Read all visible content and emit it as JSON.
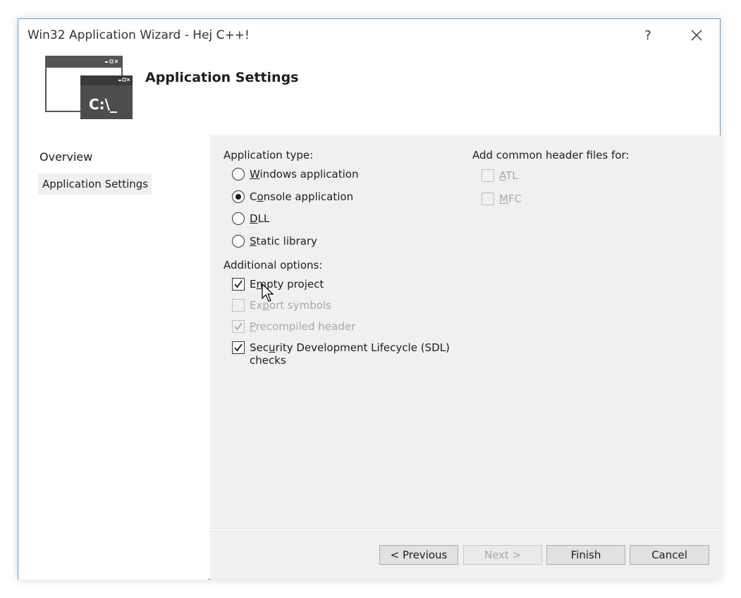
{
  "window": {
    "title": "Win32 Application Wizard - Hej C++!",
    "help_label": "?"
  },
  "header": {
    "title": "Application Settings",
    "icon_text": "C:\\_"
  },
  "sidebar": {
    "items": [
      {
        "label": "Overview"
      },
      {
        "label": "Application Settings"
      }
    ]
  },
  "app_type": {
    "label": "Application type:",
    "options": [
      {
        "pre": "",
        "u": "W",
        "post": "indows application",
        "selected": false
      },
      {
        "pre": "C",
        "u": "o",
        "post": "nsole application",
        "selected": true
      },
      {
        "pre": "",
        "u": "D",
        "post": "LL",
        "selected": false
      },
      {
        "pre": "",
        "u": "S",
        "post": "tatic library",
        "selected": false
      }
    ]
  },
  "additional": {
    "label": "Additional options:",
    "options": [
      {
        "pre": "E",
        "u": "m",
        "post": "pty project",
        "checked": true,
        "enabled": true
      },
      {
        "pre": "Ex",
        "u": "p",
        "post": "ort symbols",
        "checked": false,
        "enabled": false
      },
      {
        "pre": "",
        "u": "P",
        "post": "recompiled header",
        "checked": true,
        "enabled": false
      },
      {
        "pre": "Sec",
        "u": "u",
        "post": "rity Development Lifecycle (SDL)",
        "line2": "checks",
        "checked": true,
        "enabled": true
      }
    ]
  },
  "common_headers": {
    "label": "Add common header files for:",
    "options": [
      {
        "pre": "",
        "u": "A",
        "post": "TL",
        "checked": false,
        "enabled": false
      },
      {
        "pre": "",
        "u": "M",
        "post": "FC",
        "checked": false,
        "enabled": false
      }
    ]
  },
  "buttons": {
    "previous": "< Previous",
    "next": "Next >",
    "finish": "Finish",
    "cancel": "Cancel"
  },
  "colors": {
    "accent": "#5b9bd5",
    "panel": "#f0f0f0",
    "icon_dark": "#4d4d4d"
  }
}
